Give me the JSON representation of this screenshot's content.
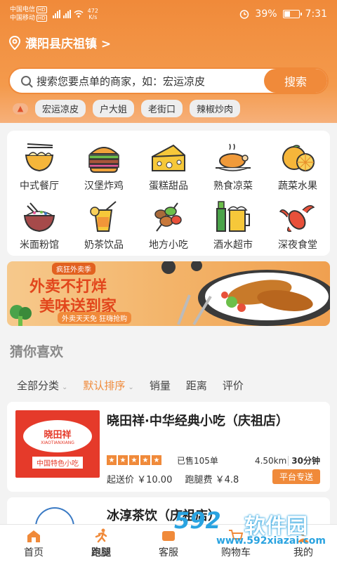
{
  "colors": {
    "accent": "#f08a3a",
    "brand_red": "#e53a2a",
    "watermark_blue": "#2aa3e0"
  },
  "status_bar": {
    "carrier1": "中国电信",
    "carrier2": "中国移动",
    "hd": "HD",
    "speed_value": "472",
    "speed_unit": "K/s",
    "battery": "39%",
    "battery_level": 0.39,
    "time": "7:31"
  },
  "location": {
    "text": "濮阳县庆祖镇 >"
  },
  "search": {
    "placeholder": "搜索您要点单的商家，如：宏运凉皮",
    "button": "搜索"
  },
  "hot_tags": [
    "宏运凉皮",
    "户大姐",
    "老街口",
    "辣椒炒肉"
  ],
  "categories": [
    {
      "label": "中式餐厅",
      "icon": "noodle-bowl-icon"
    },
    {
      "label": "汉堡炸鸡",
      "icon": "burger-icon"
    },
    {
      "label": "蛋糕甜品",
      "icon": "cheese-cake-icon"
    },
    {
      "label": "熟食凉菜",
      "icon": "roast-chicken-icon"
    },
    {
      "label": "蔬菜水果",
      "icon": "orange-fruit-icon"
    },
    {
      "label": "米面粉馆",
      "icon": "rice-bowl-icon"
    },
    {
      "label": "奶茶饮品",
      "icon": "drink-icon"
    },
    {
      "label": "地方小吃",
      "icon": "skewer-icon"
    },
    {
      "label": "酒水超市",
      "icon": "beer-icon"
    },
    {
      "label": "深夜食堂",
      "icon": "lobster-icon"
    }
  ],
  "banner": {
    "tag": "疯狂外卖季",
    "line1": "外卖不打烊",
    "line2": "美味送到家",
    "line3": "外卖天天免 狂嗨抢购"
  },
  "section_title": "猜你喜欢",
  "sort_options": [
    "全部分类",
    "默认排序",
    "销量",
    "距离",
    "评价"
  ],
  "shops": [
    {
      "name": "晓田祥·中华经典小吃（庆祖店）",
      "logo_cn": "晓田祥",
      "logo_py": "XIAOTIANXIANG",
      "logo_foot": "中国特色小吃",
      "sold": "已售105单",
      "distance": "4.50km",
      "eta": "30分钟",
      "min_order": "起送价 ￥10.00",
      "delivery_fee": "跑腿费 ￥4.8",
      "badge": "平台专送",
      "stars": 5
    },
    {
      "name": "冰淳茶饮（庆祖店）"
    }
  ],
  "tabs": [
    {
      "label": "首页",
      "icon": "home-icon"
    },
    {
      "label": "跑腿",
      "icon": "runner-icon"
    },
    {
      "label": "客服",
      "icon": "service-icon"
    },
    {
      "label": "购物车",
      "icon": "cart-icon"
    },
    {
      "label": "我的",
      "icon": "user-icon"
    }
  ],
  "watermark": {
    "brand": "592",
    "name": "软件园",
    "url": "www.592xiazai.com"
  }
}
